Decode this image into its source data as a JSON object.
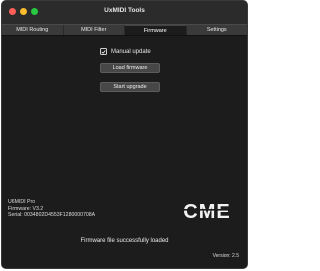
{
  "window": {
    "title": "UxMIDI Tools"
  },
  "tabs": [
    {
      "label": "MIDI Routing",
      "active": false
    },
    {
      "label": "MIDI Filter",
      "active": false
    },
    {
      "label": "Firmware",
      "active": true
    },
    {
      "label": "Settings",
      "active": false
    }
  ],
  "firmware": {
    "manual_update_label": "Manual update",
    "manual_update_checked": true,
    "load_button": "Load firmware",
    "upgrade_button": "Start upgrade",
    "status": "Firmware file successfully loaded"
  },
  "device": {
    "name": "U6MIDI Pro",
    "firmware": "Firmware: V3.2",
    "serial": "Serial: 0034802D4553F1280000708A"
  },
  "logo": {
    "text": "CME"
  },
  "footer": {
    "version": "Version: 2.5"
  },
  "colors": {
    "window_bg": "#1c1c1c",
    "titlebar_bg": "#2b2b2b",
    "tab_bg": "#3a3a3a",
    "button_bg": "#474747",
    "text": "#e8e8e8"
  }
}
